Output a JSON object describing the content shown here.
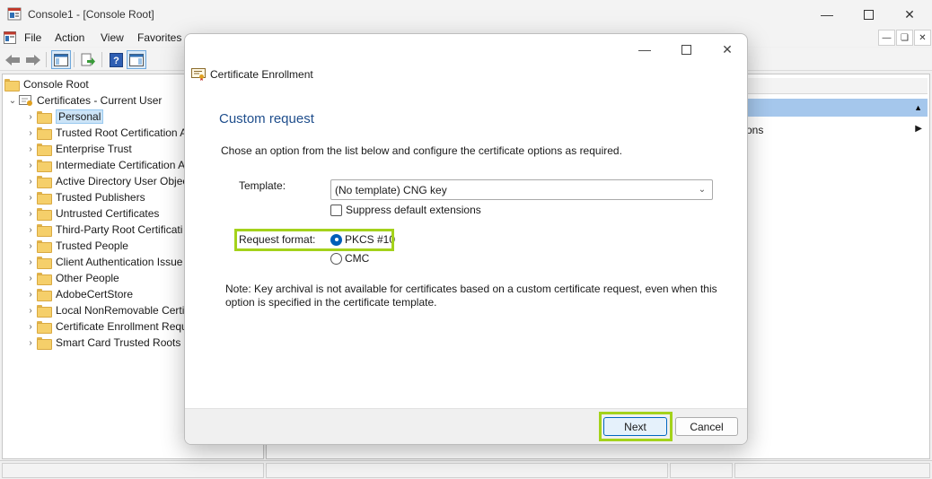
{
  "window": {
    "title": "Console1 - [Console Root]",
    "controls": [
      "minimize-icon",
      "maximize-icon",
      "close-icon"
    ]
  },
  "menu": {
    "items": [
      "File",
      "Action",
      "View",
      "Favorites"
    ]
  },
  "tree": {
    "root": "Console Root",
    "store": "Certificates - Current User",
    "items": [
      "Personal",
      "Trusted Root Certification A",
      "Enterprise Trust",
      "Intermediate Certification A",
      "Active Directory User Objec",
      "Trusted Publishers",
      "Untrusted Certificates",
      "Third-Party Root Certificati",
      "Trusted People",
      "Client Authentication Issue",
      "Other People",
      "AdobeCertStore",
      "Local NonRemovable Certifi",
      "Certificate Enrollment Requ",
      "Smart Card Trusted Roots"
    ],
    "selected_index": 0
  },
  "actions": {
    "item": "ons"
  },
  "dialog": {
    "title": "Certificate Enrollment",
    "heading": "Custom request",
    "instructions": "Chose an option from the list below and configure the certificate options as required.",
    "template_label": "Template:",
    "template_value": "(No template) CNG key",
    "suppress_label": "Suppress default extensions",
    "request_format_label": "Request format:",
    "format_options": [
      "PKCS #10",
      "CMC"
    ],
    "selected_format": "PKCS #10",
    "note": "Note: Key archival is not available for certificates based on a custom certificate request, even when this option is specified in the certificate template.",
    "next_label": "Next",
    "cancel_label": "Cancel",
    "highlight_color": "#a4d21b"
  }
}
